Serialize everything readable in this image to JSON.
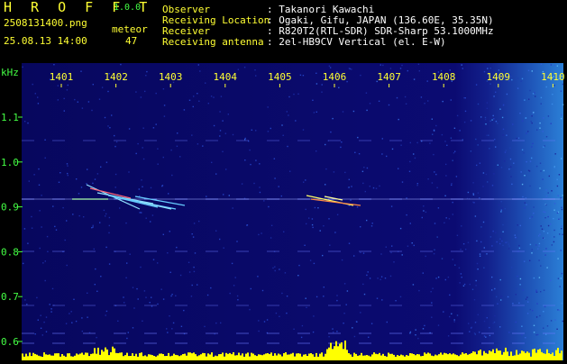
{
  "app": {
    "title": "H R O F F T",
    "version": "1.0.0"
  },
  "file": {
    "name": "2508131400.png",
    "datetime": "25.08.13 14:00"
  },
  "meteor": {
    "label": "meteor",
    "count": "47"
  },
  "info": [
    {
      "label": "Observer",
      "value": ": Takanori Kawachi"
    },
    {
      "label": "Receiving Location",
      "value": ": Ogaki, Gifu, JAPAN (136.60E, 35.35N)"
    },
    {
      "label": "Receiver",
      "value": ": R820T2(RTL-SDR) SDR-Sharp 53.1000MHz"
    },
    {
      "label": "Receiving antenna",
      "value": ": 2el-HB9CV Vertical (el. E-W)"
    }
  ],
  "yaxis": {
    "unit": "kHz",
    "ticks": [
      "1.1",
      "1.0",
      "0.9",
      "0.8",
      "0.7",
      "0.6"
    ]
  },
  "xaxis": {
    "ticks": [
      "1401",
      "1402",
      "1403",
      "1404",
      "1405",
      "1406",
      "1407",
      "1408",
      "1409",
      "1410"
    ]
  },
  "colors": {
    "background": "#000000",
    "spectrum_base": "#0a0a6e",
    "title": "#ffff33",
    "label": "#44ff44",
    "text": "#ffffff",
    "signal": "#ffff00"
  }
}
